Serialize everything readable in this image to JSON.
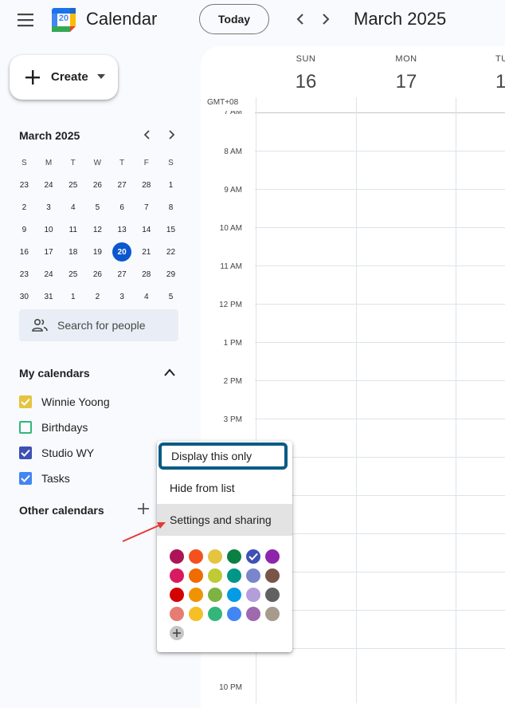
{
  "header": {
    "app_title": "Calendar",
    "logo_day": "20",
    "today_label": "Today",
    "current_range": "March 2025"
  },
  "create": {
    "label": "Create"
  },
  "mini_calendar": {
    "title": "March 2025",
    "weekday_headers": [
      "S",
      "M",
      "T",
      "W",
      "T",
      "F",
      "S"
    ],
    "weeks": [
      [
        "23",
        "24",
        "25",
        "26",
        "27",
        "28",
        "1"
      ],
      [
        "2",
        "3",
        "4",
        "5",
        "6",
        "7",
        "8"
      ],
      [
        "9",
        "10",
        "11",
        "12",
        "13",
        "14",
        "15"
      ],
      [
        "16",
        "17",
        "18",
        "19",
        "20",
        "21",
        "22"
      ],
      [
        "23",
        "24",
        "25",
        "26",
        "27",
        "28",
        "29"
      ],
      [
        "30",
        "31",
        "1",
        "2",
        "3",
        "4",
        "5"
      ]
    ],
    "selected": "20"
  },
  "search": {
    "label": "Search for people"
  },
  "my_calendars": {
    "title": "My calendars",
    "items": [
      {
        "label": "Winnie Yoong",
        "color": "#e4c441",
        "checked": true
      },
      {
        "label": "Birthdays",
        "color": "#33b679",
        "checked": false
      },
      {
        "label": "Studio WY",
        "color": "#3f51b5",
        "checked": true
      },
      {
        "label": "Tasks",
        "color": "#4285f4",
        "checked": true
      }
    ]
  },
  "other_calendars": {
    "title": "Other calendars"
  },
  "week_view": {
    "timezone": "GMT+08",
    "days": [
      {
        "name": "SUN",
        "num": "16"
      },
      {
        "name": "MON",
        "num": "17"
      },
      {
        "name": "TU",
        "num": "1"
      }
    ],
    "hours": [
      "7 AM",
      "8 AM",
      "9 AM",
      "10 AM",
      "11 AM",
      "12 PM",
      "1 PM",
      "2 PM",
      "3 PM",
      "10 PM"
    ]
  },
  "context_menu": {
    "items": [
      "Display this only",
      "Hide from list",
      "Settings and sharing"
    ],
    "colors": [
      [
        "#ad1457",
        "#f4511e",
        "#e4c441",
        "#0b8043",
        "#3f51b5",
        "#8e24aa"
      ],
      [
        "#d81b60",
        "#ef6c00",
        "#c0ca33",
        "#009688",
        "#7986cb",
        "#795548"
      ],
      [
        "#d50000",
        "#f09300",
        "#7cb342",
        "#039be5",
        "#b39ddb",
        "#616161"
      ],
      [
        "#e67c73",
        "#f6bf26",
        "#33b679",
        "#4285f4",
        "#9e69af",
        "#a79b8e"
      ]
    ],
    "selected_color": "#3f51b5"
  }
}
